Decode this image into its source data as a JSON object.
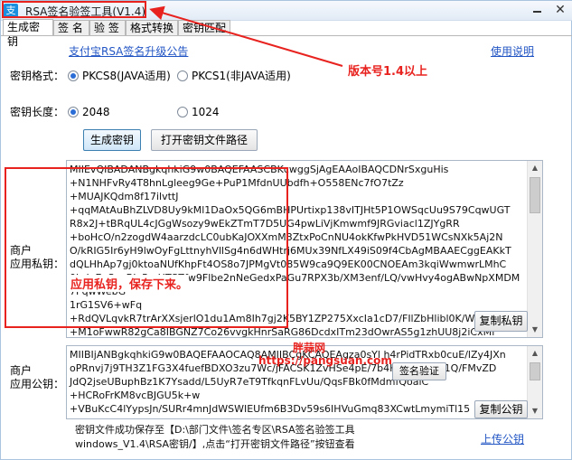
{
  "window": {
    "icon_text": "支",
    "title": "RSA签名验签工具(V1.4)",
    "close_glyph": "✕"
  },
  "tabs": [
    {
      "label": "生成密钥"
    },
    {
      "label": "签 名"
    },
    {
      "label": "验 签"
    },
    {
      "label": "格式转换"
    },
    {
      "label": "密钥匹配"
    }
  ],
  "header": {
    "upgrade_link": "支付宝RSA签名升级公告",
    "help_link": "使用说明"
  },
  "key_format": {
    "label": "密钥格式：",
    "options": [
      {
        "label": "PKCS8(JAVA适用)",
        "checked": true
      },
      {
        "label": "PKCS1(非JAVA适用)",
        "checked": false
      }
    ]
  },
  "version_note": "版本号1.4以上",
  "key_length": {
    "label": "密钥长度：",
    "options": [
      {
        "label": "2048",
        "checked": true
      },
      {
        "label": "1024",
        "checked": false
      }
    ]
  },
  "buttons": {
    "generate": "生成密钥",
    "open_path": "打开密钥文件路径",
    "copy_private": "复制私钥",
    "copy_public": "复制公钥",
    "verify": "签名验证"
  },
  "private_key": {
    "label_line1": "商户",
    "label_line2": "应用私钥：",
    "text": "MIIEvQIBADANBgkqhkiG9w0BAQEFAASCBKcwggSjAgEAAoIBAQCDNrSxguHis\n+N1NHFvRy4T8hnLgleeg9Ge+PuP1MfdnUUbdfh+O558ENc7fO7tZz\n+MUAJKQdm8f17ilvttJ\n+qqMAtAuBhZLVD8Uy9kMl1DaOx5QG6mBHPUrtixp138vITJHt5P1OWSqcUu9S79CqwUGT\nR8x2J+tBRqUL4cJGgWsozy9wEkZTmT7D5UG4pwLiVjKmwmf9JRGviacl1ZJYgRR\n+boHcO/n2zogdW4aarzdcLC0ubKaJOXXmM3ZtxPoCnNU4okKfwPkHVD51WCsNXk5Aj2N\nO/kRIG5Ir6yH9lwOyFgLttnyhVllSg4n6dWHtrj6MUx39NfLX49iS09f4CbAgMBAAECggEAKkT\ndQLHhAp7gj0ktoaNUfKhpFt4OS8o7JPMgVt085W9ca9Q9EK00CNOEAm3kqiWwmwrLMhC\n0hrJeEgSvoBJy5mHTCZfw9Flbe2nNeGedxPaGu7RPX3b/XM3enf/LQ/vwHvy4ogABwNpXMDM7PqwWebG\n1rG1SV6+wFq\n+RdQVLqvkR7trArXXsjerlO1du1Am8Ih7gj2K5BY1ZP275XxcIa1cD7/FIlZbHlibl0K/W\n+M1oFwwR82gCa8IBGNZ7Co26vvgkHnrSaRG86DcdxITm23dOwrAS5g1zhUU8j2iCxMf"
  },
  "private_note": "应用私钥，保存下来。",
  "public_key": {
    "label_line1": "商户",
    "label_line2": "应用公钥：",
    "text": "MIIBIjANBgkqhkiG9w0BAQEFAAOCAQ8AMIIBCgKCAQEAgza0sYl h4rPidTRxb0cuE/lZy4JXn\noPRnvj7j9TH3Z1FG3X4fuefBDXO3zu7Wc/jFACSK1ZvHSe4pE/7b4HJNiMTZ2S1Q/FMvZD\nJdQ2jseUBuphBz1K7Ysadd/L5UyR7eT9TfkqnFLvUu/QqsFBk0fMdmfQoalC\n+HCRoFrKM8vcBJGU5k+w\n+VBuKcC4lYypsJn/SURr4mnJdWSWIEUfm6B3Dv59s6IHVuGmq83XCwtLmymiTl15"
  },
  "watermark": {
    "line1": "胖蒜网",
    "line2": "https://pangsuan.com"
  },
  "status": {
    "line1": "密钥文件成功保存至【D:\\部门文件\\签名专区\\RSA签名验签工具",
    "line2": "windows_V1.4\\RSA密钥/】,点击“打开密钥文件路径”按钮查看"
  },
  "upload_public_link": "上传公钥",
  "colors": {
    "accent_red": "#e8231f",
    "link_blue": "#2255c4"
  }
}
